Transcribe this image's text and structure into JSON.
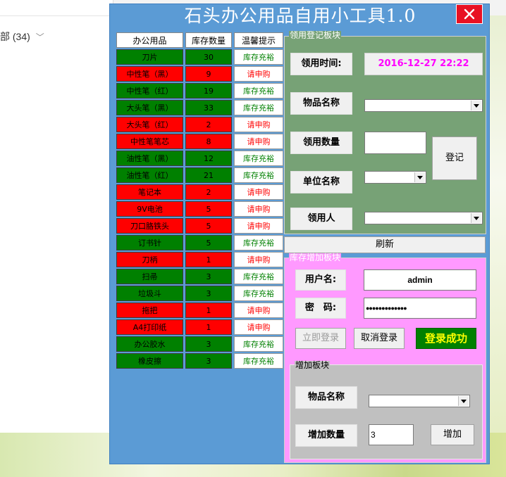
{
  "background": {
    "explorer_label": "部 (34)"
  },
  "window": {
    "title": "石头办公用品自用小工具1.0",
    "close_glyph": "✕"
  },
  "stock_table": {
    "headers": [
      "办公用品",
      "库存数量",
      "温馨提示"
    ],
    "rows": [
      {
        "name": "刀片",
        "qty": "30",
        "tip": "库存充裕",
        "status": "ok"
      },
      {
        "name": "中性笔（黑）",
        "qty": "9",
        "tip": "请申购",
        "status": "low"
      },
      {
        "name": "中性笔（红）",
        "qty": "19",
        "tip": "库存充裕",
        "status": "ok"
      },
      {
        "name": "大头笔（黑）",
        "qty": "33",
        "tip": "库存充裕",
        "status": "ok"
      },
      {
        "name": "大头笔（红）",
        "qty": "2",
        "tip": "请申购",
        "status": "low"
      },
      {
        "name": "中性笔笔芯",
        "qty": "8",
        "tip": "请申购",
        "status": "low"
      },
      {
        "name": "油性笔（黑）",
        "qty": "12",
        "tip": "库存充裕",
        "status": "ok"
      },
      {
        "name": "油性笔（红）",
        "qty": "21",
        "tip": "库存充裕",
        "status": "ok"
      },
      {
        "name": "笔记本",
        "qty": "2",
        "tip": "请申购",
        "status": "low"
      },
      {
        "name": "9V电池",
        "qty": "5",
        "tip": "请申购",
        "status": "low"
      },
      {
        "name": "刀口胳铁头",
        "qty": "5",
        "tip": "请申购",
        "status": "low"
      },
      {
        "name": "订书针",
        "qty": "5",
        "tip": "库存充裕",
        "status": "ok"
      },
      {
        "name": "刀柄",
        "qty": "1",
        "tip": "请申购",
        "status": "low"
      },
      {
        "name": "扫帚",
        "qty": "3",
        "tip": "库存充裕",
        "status": "ok"
      },
      {
        "name": "垃圾斗",
        "qty": "3",
        "tip": "库存充裕",
        "status": "ok"
      },
      {
        "name": "拖把",
        "qty": "1",
        "tip": "请申购",
        "status": "low"
      },
      {
        "name": "A4打印纸",
        "qty": "1",
        "tip": "请申购",
        "status": "low"
      },
      {
        "name": "办公胶水",
        "qty": "3",
        "tip": "库存充裕",
        "status": "ok"
      },
      {
        "name": "橡皮擦",
        "qty": "3",
        "tip": "库存充裕",
        "status": "ok"
      }
    ]
  },
  "register_panel": {
    "legend": "领用登记板块",
    "time_label": "领用时间:",
    "time_value": "2016-12-27   22:22",
    "item_label": "物品名称",
    "item_value": "",
    "qty_label": "领用数量",
    "qty_value": "",
    "unit_label": "单位名称",
    "unit_value": "",
    "person_label": "领用人",
    "person_value": "",
    "register_button": "登记"
  },
  "refresh_button": "刷新",
  "stock_panel": {
    "legend": "库存增加板块",
    "username_label": "用户名:",
    "username_value": "admin",
    "password_label": "密　码:",
    "password_value": "●●●●●●●●●●●●●",
    "login_button": "立即登录",
    "cancel_button": "取消登录",
    "login_status": "登录成功"
  },
  "add_panel": {
    "legend": "增加板块",
    "item_label": "物品名称",
    "item_value": "",
    "qty_label": "增加数量",
    "qty_value": "3",
    "add_button": "增加"
  },
  "colors": {
    "window_bg": "#5b9bd5",
    "ok_cell": "#008000",
    "low_cell": "#ff0000",
    "register_panel": "#77a276",
    "stock_panel": "#ff99ff",
    "add_panel": "#c0c0c0",
    "close_button": "#e81123"
  }
}
